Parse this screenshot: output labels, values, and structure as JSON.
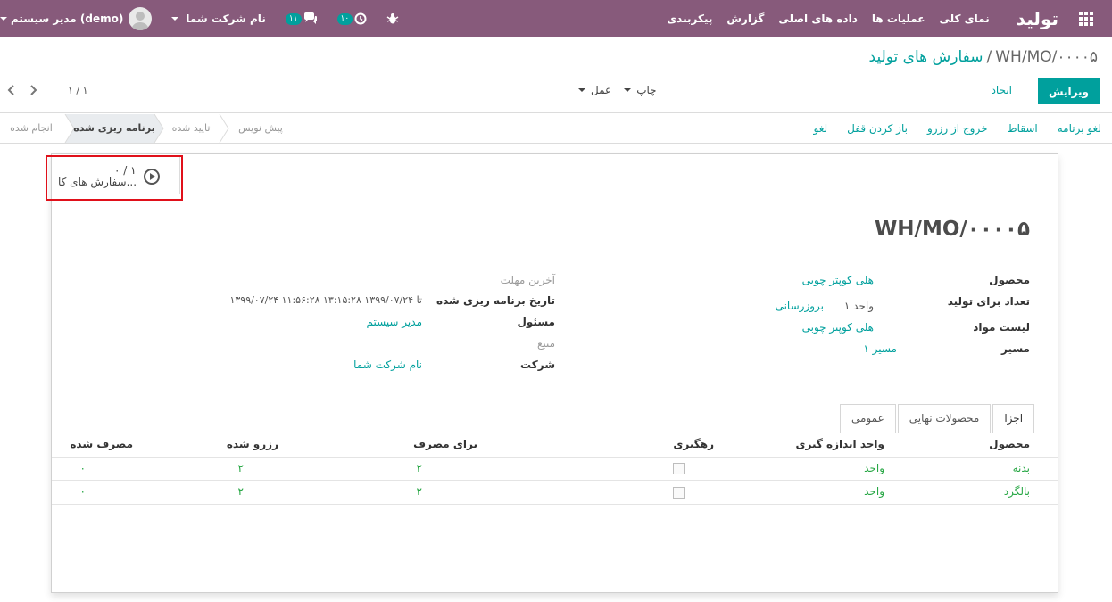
{
  "navbar": {
    "brand": "تولید",
    "menu": [
      "نمای کلی",
      "عملیات ها",
      "داده های اصلی",
      "گزارش",
      "پیکربندی"
    ],
    "user_name": "مدیر سیستم (demo)",
    "company_name": "نام شرکت شما",
    "messages_count": "۱۱",
    "activities_count": "۱۰"
  },
  "breadcrumb": {
    "parent": "سفارش های تولید",
    "separator": "/",
    "current": "WH/MO/۰۰۰۰۵"
  },
  "toolbar": {
    "edit_label": "ویرایش",
    "create_label": "ایجاد",
    "print_label": "چاپ",
    "action_label": "عمل"
  },
  "pager": {
    "value": "۱ / ۱"
  },
  "actions": [
    "لغو برنامه",
    "اسقاط",
    "خروج از رزرو",
    "باز کردن قفل",
    "لغو"
  ],
  "stages": [
    "انجام شده",
    "برنامه ریزی شده",
    "تایید شده",
    "پیش نویس"
  ],
  "stat_button": {
    "value": "۰ / ۱",
    "label": "سفارش های کا..."
  },
  "record": {
    "title": "WH/MO/۰۰۰۰۵",
    "right_fields": {
      "product_label": "محصول",
      "product_value": "هلی کوپتر چوبی",
      "qty_label": "تعداد برای تولید",
      "qty_value": "۱ واحد",
      "qty_update": "بروزرسانی",
      "bom_label": "لیست مواد",
      "bom_value": "هلی کوپتر چوبی",
      "route_label": "مسیر",
      "route_value": "مسیر ۱"
    },
    "left_fields": {
      "deadline_label": "آخرین مهلت",
      "scheduled_label": "تاریخ برنامه ریزی شده",
      "scheduled_value": "۱۳۹۹/۰۷/۲۴ ۱۱:۵۶:۲۸ تا ۱۳۹۹/۰۷/۲۴ ۱۳:۱۵:۲۸",
      "responsible_label": "مسئول",
      "responsible_value": "مدیر سیستم",
      "source_label": "منبع",
      "company_label": "شرکت",
      "company_value": "نام شرکت شما"
    }
  },
  "tabs": [
    "اجزا",
    "محصولات نهایی",
    "عمومی"
  ],
  "table": {
    "headers": [
      "محصول",
      "واحد اندازه گیری",
      "رهگیری",
      "برای مصرف",
      "رزرو شده",
      "مصرف شده"
    ],
    "rows": [
      {
        "product": "بدنه",
        "uom": "واحد",
        "to_consume": "۲",
        "reserved": "۲",
        "consumed": "۰"
      },
      {
        "product": "بالگرد",
        "uom": "واحد",
        "to_consume": "۲",
        "reserved": "۲",
        "consumed": "۰"
      }
    ]
  },
  "colors": {
    "navbar": "#875a7b",
    "accent": "#00a09d",
    "highlight": "#e0101a"
  }
}
